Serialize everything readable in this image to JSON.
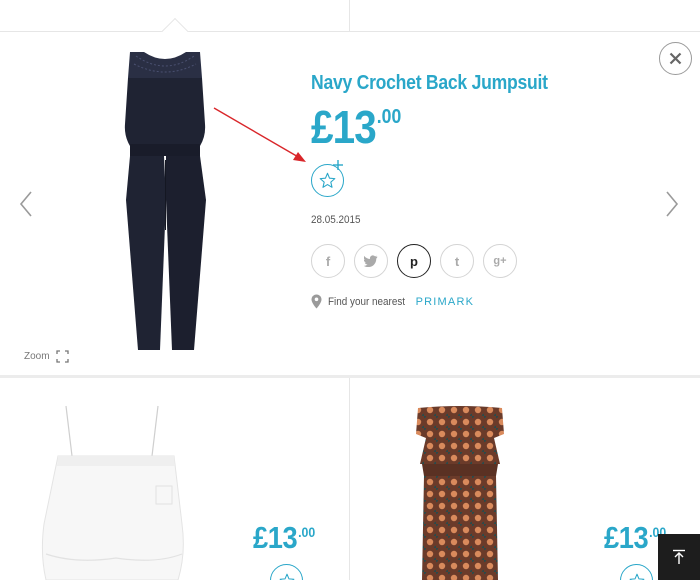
{
  "product": {
    "title": "Navy Crochet Back Jumpsuit",
    "price_main": "£13",
    "price_pence": ".00",
    "date": "28.05.2015",
    "zoom_label": "Zoom",
    "store_prefix": "Find your nearest",
    "store_brand": "PRIMARK"
  },
  "share": {
    "facebook": "f",
    "twitter": "t",
    "pinterest": "p",
    "tumblr": "t",
    "googleplus": "g+"
  },
  "cards": [
    {
      "price_main": "£13",
      "price_pence": ".00"
    },
    {
      "price_main": "£13",
      "price_pence": ".00"
    }
  ],
  "colors": {
    "accent": "#2aa7c9",
    "jumpsuit": "#1f2333",
    "annotation_arrow": "#d9262a"
  },
  "icons": {
    "close": "close-icon",
    "prev": "chevron-left-icon",
    "next": "chevron-right-icon",
    "wishlist": "star-icon",
    "zoom": "expand-icon",
    "location": "map-pin-icon",
    "back_to_top": "arrow-up-icon"
  }
}
